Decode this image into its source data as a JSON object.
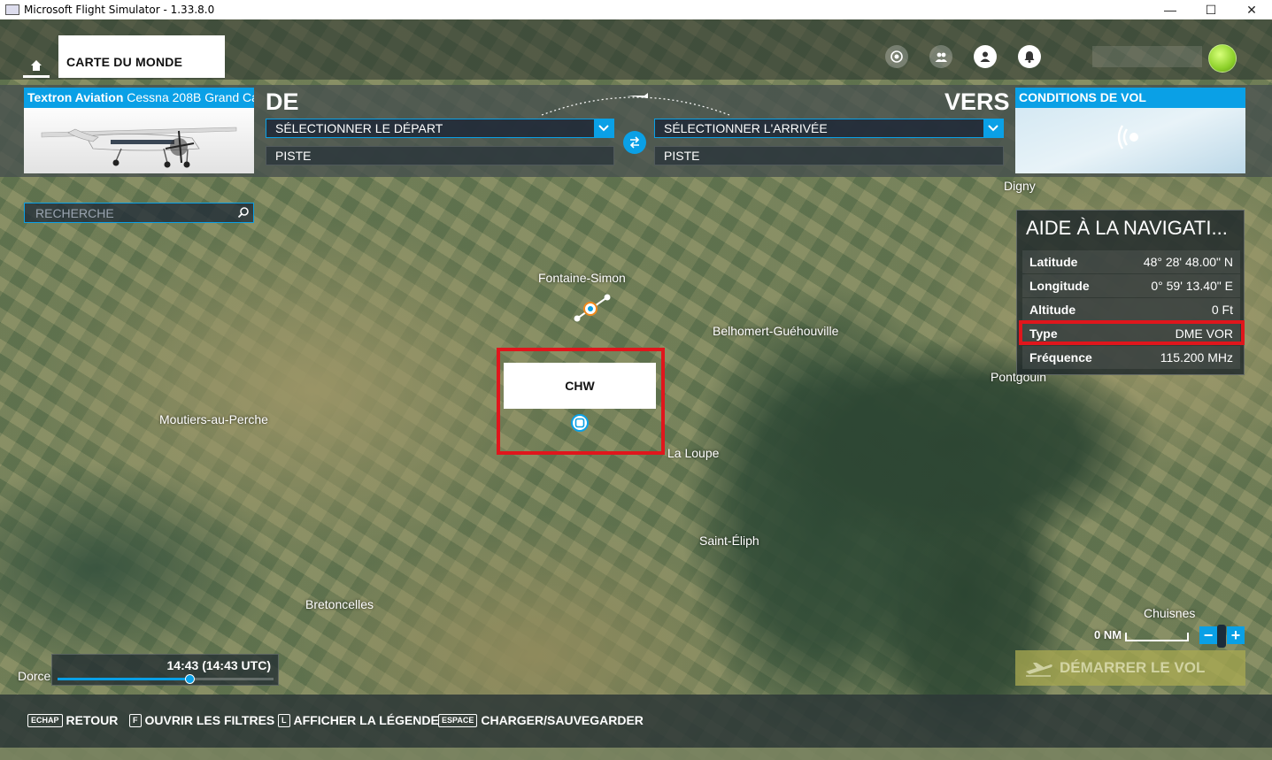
{
  "window": {
    "title": "Microsoft Flight Simulator - 1.33.8.0",
    "minimize": "—",
    "maximize": "☐",
    "close": "✕"
  },
  "nav": {
    "active_tab": "CARTE DU MONDE",
    "icons": [
      "activity-icon",
      "friends-icon",
      "profile-icon",
      "notifications-icon"
    ]
  },
  "aircraft": {
    "brand": "Textron Aviation",
    "model": "Cessna 208B Grand Ca"
  },
  "route": {
    "from_label": "DE",
    "to_label": "VERS",
    "departure_select": "SÉLECTIONNER LE DÉPART",
    "departure_runway": "PISTE",
    "arrival_select": "SÉLECTIONNER L'ARRIVÉE",
    "arrival_runway": "PISTE"
  },
  "conditions": {
    "label": "CONDITIONS DE VOL"
  },
  "search": {
    "placeholder": "RECHERCHE"
  },
  "map": {
    "places": {
      "digny": "Digny",
      "fontaine": "Fontaine-Simon",
      "belhomert": "Belhomert-Guéhouville",
      "pontgouin": "Pontgouin",
      "moutiers": "Moutiers-au-Perche",
      "la_loupe": "La Loupe",
      "saint_eliph": "Saint-Éliph",
      "bretoncelles": "Bretoncelles",
      "chuisnes": "Chuisnes",
      "dorce": "Dorce"
    },
    "callout_label": "CHW"
  },
  "navaid": {
    "header": "AIDE À LA NAVIGATI...",
    "rows": [
      {
        "key": "Latitude",
        "value": "48° 28' 48.00\" N"
      },
      {
        "key": "Longitude",
        "value": "0° 59' 13.40\" E"
      },
      {
        "key": "Altitude",
        "value": "0 Ft"
      },
      {
        "key": "Type",
        "value": "DME VOR"
      },
      {
        "key": "Fréquence",
        "value": "115.200 MHz"
      }
    ]
  },
  "scale": {
    "label": "0 NM"
  },
  "zoom": {
    "out": "−",
    "in": "+"
  },
  "start_flight": "DÉMARRER LE VOL",
  "time": {
    "display": "14:43 (14:43 UTC)",
    "slider_fraction": 0.61
  },
  "hints": [
    {
      "key": "ECHAP",
      "label": "RETOUR"
    },
    {
      "key": "F",
      "label": "OUVRIR LES FILTRES"
    },
    {
      "key": "L",
      "label": "AFFICHER LA LÉGENDE"
    },
    {
      "key": "ESPACE",
      "label": "CHARGER/SAUVEGARDER"
    }
  ],
  "colors": {
    "accent": "#0aa0e6",
    "highlight": "#e0161c"
  }
}
